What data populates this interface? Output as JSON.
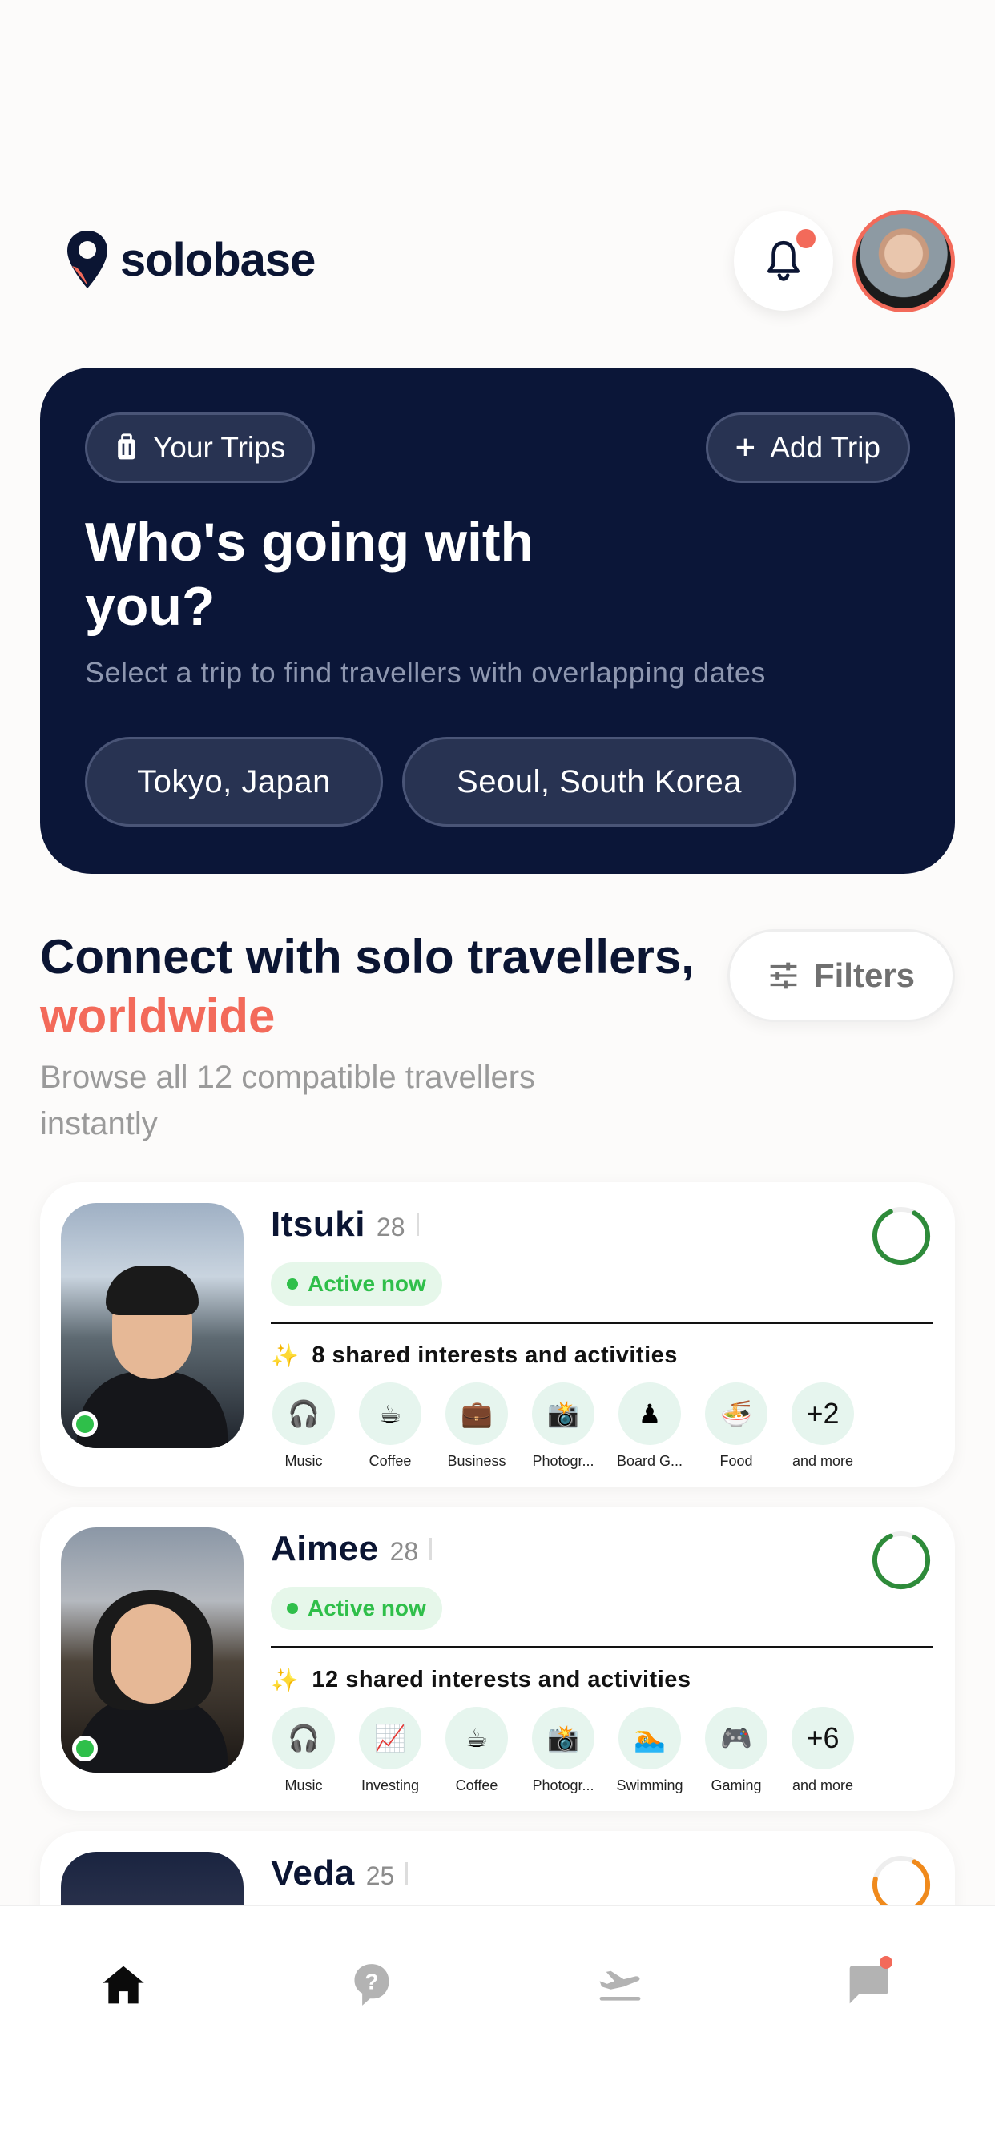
{
  "brand": {
    "name": "solobase"
  },
  "hero": {
    "your_trips": "Your Trips",
    "add_trip": "Add Trip",
    "title": "Who's going with you?",
    "subtitle": "Select a trip to find travellers with overlapping dates",
    "trips": [
      "Tokyo, Japan",
      "Seoul, South Korea"
    ]
  },
  "connect": {
    "title_main": "Connect with solo travellers, ",
    "title_accent": "worldwide",
    "subtitle": "Browse all 12 compatible travellers instantly",
    "filters": "Filters"
  },
  "travellers": [
    {
      "name": "Itsuki",
      "age": "28",
      "status": "Active now",
      "shared": "8 shared interests and activities",
      "ring_color": "#2e8b3a",
      "ring_progress": 0.85,
      "interests": [
        {
          "icon": "🎧",
          "label": "Music"
        },
        {
          "icon": "☕",
          "label": "Coffee"
        },
        {
          "icon": "💼",
          "label": "Business"
        },
        {
          "icon": "📸",
          "label": "Photogr..."
        },
        {
          "icon": "♟",
          "label": "Board G..."
        },
        {
          "icon": "🍜",
          "label": "Food"
        },
        {
          "icon": "+2",
          "label": "and more"
        }
      ]
    },
    {
      "name": "Aimee",
      "age": "28",
      "status": "Active now",
      "shared": "12 shared interests and activities",
      "ring_color": "#2e8b3a",
      "ring_progress": 0.85,
      "interests": [
        {
          "icon": "🎧",
          "label": "Music"
        },
        {
          "icon": "📈",
          "label": "Investing"
        },
        {
          "icon": "☕",
          "label": "Coffee"
        },
        {
          "icon": "📸",
          "label": "Photogr..."
        },
        {
          "icon": "🏊",
          "label": "Swimming"
        },
        {
          "icon": "🎮",
          "label": "Gaming"
        },
        {
          "icon": "+6",
          "label": "and more"
        }
      ]
    },
    {
      "name": "Veda",
      "age": "25",
      "ring_color": "#f08a1c",
      "ring_progress": 0.7
    }
  ],
  "colors": {
    "navy": "#0b1638",
    "accent": "#f36a5a",
    "green": "#2fbf4a"
  },
  "nav": [
    "home-icon",
    "question-icon",
    "flight-icon",
    "chat-icon"
  ]
}
